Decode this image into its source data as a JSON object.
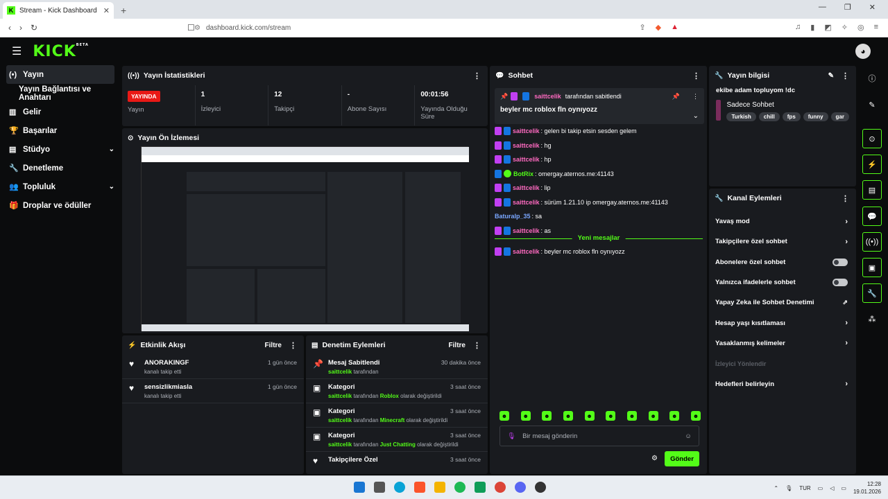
{
  "browser": {
    "tab_title": "Stream - Kick Dashboard",
    "tab_favicon": "K",
    "url": "dashboard.kick.com/stream"
  },
  "brand": {
    "logo": "KICK",
    "beta": "BETA",
    "accent": "#53fc18",
    "live_red": "#e91916"
  },
  "sidebar": {
    "items": [
      {
        "label": "Yayın",
        "icon": "broadcast-icon"
      },
      {
        "label": "Yayın Bağlantısı ve Anahtarı",
        "icon": ""
      },
      {
        "label": "Gelir",
        "icon": "chart-icon"
      },
      {
        "label": "Başarılar",
        "icon": "trophy-icon"
      },
      {
        "label": "Stüdyo",
        "icon": "studio-icon"
      },
      {
        "label": "Denetleme",
        "icon": "wrench-icon"
      },
      {
        "label": "Topluluk",
        "icon": "community-icon"
      },
      {
        "label": "Droplar ve ödüller",
        "icon": "gift-icon"
      }
    ]
  },
  "stats": {
    "title": "Yayın İstatistikleri",
    "items": [
      {
        "value": "YAYINDA",
        "label": "Yayın"
      },
      {
        "value": "1",
        "label": "İzleyici"
      },
      {
        "value": "12",
        "label": "Takipçi"
      },
      {
        "value": "-",
        "label": "Abone Sayısı"
      },
      {
        "value": "00:01:56",
        "label": "Yayında Olduğu Süre"
      }
    ]
  },
  "preview": {
    "title": "Yayın Ön İzlemesi"
  },
  "activity": {
    "title": "Etkinlik Akışı",
    "filter": "Filtre",
    "items": [
      {
        "name": "ANORAKINGF",
        "desc": "kanalı takip etti",
        "time": "1 gün önce"
      },
      {
        "name": "sensizlikmiasla",
        "desc": "kanalı takip etti",
        "time": "1 gün önce"
      }
    ]
  },
  "modlog": {
    "title": "Denetim Eylemleri",
    "filter": "Filtre",
    "items": [
      {
        "title": "Mesaj Sabitlendi",
        "user": "saittcelik",
        "mid": "tarafından",
        "obj": "",
        "end": "",
        "time": "30 dakika önce"
      },
      {
        "title": "Kategori",
        "user": "saittcelik",
        "mid": "tarafından",
        "obj": "Roblox",
        "end": "olarak değiştirildi",
        "time": "3 saat önce"
      },
      {
        "title": "Kategori",
        "user": "saittcelik",
        "mid": "tarafından",
        "obj": "Minecraft",
        "end": "olarak değiştirildi",
        "time": "3 saat önce"
      },
      {
        "title": "Kategori",
        "user": "saittcelik",
        "mid": "tarafından",
        "obj": "Just Chatting",
        "end": "olarak değiştirildi",
        "time": "3 saat önce"
      },
      {
        "title": "Takipçilere Özel",
        "user": "",
        "mid": "",
        "obj": "",
        "end": "",
        "time": "3 saat önce"
      }
    ]
  },
  "chat": {
    "title": "Sohbet",
    "pinned": {
      "user": "saittcelik",
      "by": "tarafından sabitlendi",
      "message": "beyler mc roblox fln oynıyozz"
    },
    "messages": [
      {
        "user": "saittcelik",
        "text": ": gelen bi takip etsin sesden gelem",
        "color": "#ff6ac1",
        "badges": "mic-mod"
      },
      {
        "user": "saittcelik",
        "text": ": hg",
        "color": "#ff6ac1",
        "badges": "mic-mod"
      },
      {
        "user": "saittcelik",
        "text": ": hp",
        "color": "#ff6ac1",
        "badges": "mic-mod"
      },
      {
        "user": "BotRix",
        "text": ": omergay.aternos.me:41143",
        "color": "#53fc18",
        "badges": "mod-ok"
      },
      {
        "user": "saittcelik",
        "text": ": lip",
        "color": "#ff6ac1",
        "badges": "mic-mod"
      },
      {
        "user": "saittcelik",
        "text": ": sürüm 1.21.10 ip omergay.aternos.me:41143",
        "color": "#ff6ac1",
        "badges": "mic-mod"
      },
      {
        "user": "Baturalp_35",
        "text": ": sa",
        "color": "#7aa7ff",
        "badges": ""
      },
      {
        "user": "saittcelik",
        "text": ": as",
        "color": "#ff6ac1",
        "badges": "mic-mod"
      }
    ],
    "new_messages": "Yeni mesajlar",
    "after": [
      {
        "user": "saittcelik",
        "text": ": beyler mc roblox fln oynıyozz",
        "color": "#ff6ac1",
        "badges": "mic-mod"
      }
    ],
    "input_placeholder": "Bir mesaj gönderin",
    "send": "Gönder"
  },
  "info": {
    "title": "Yayın bilgisi",
    "stream_title": "ekibe adam topluyom !dc",
    "category": "Sadece Sohbet",
    "tags": [
      "Turkish",
      "chill",
      "fps",
      "funny",
      "gar"
    ]
  },
  "actions": {
    "title": "Kanal Eylemleri",
    "items": [
      {
        "label": "Yavaş mod",
        "kind": "arrow"
      },
      {
        "label": "Takipçilere özel sohbet",
        "kind": "arrow"
      },
      {
        "label": "Abonelere özel sohbet",
        "kind": "toggle"
      },
      {
        "label": "Yalnızca ifadelerle sohbet",
        "kind": "toggle"
      },
      {
        "label": "Yapay Zeka ile Sohbet Denetimi",
        "kind": "external"
      },
      {
        "label": "Hesap yaşı kısıtlaması",
        "kind": "arrow"
      },
      {
        "label": "Yasaklanmış kelimeler",
        "kind": "arrow"
      },
      {
        "label": "İzleyici Yönlendir",
        "kind": "disabled"
      },
      {
        "label": "Hedefleri belirleyin",
        "kind": "arrow"
      }
    ]
  },
  "taskbar": {
    "lang": "TUR",
    "time": "12:28",
    "date": "19.01.2026"
  }
}
